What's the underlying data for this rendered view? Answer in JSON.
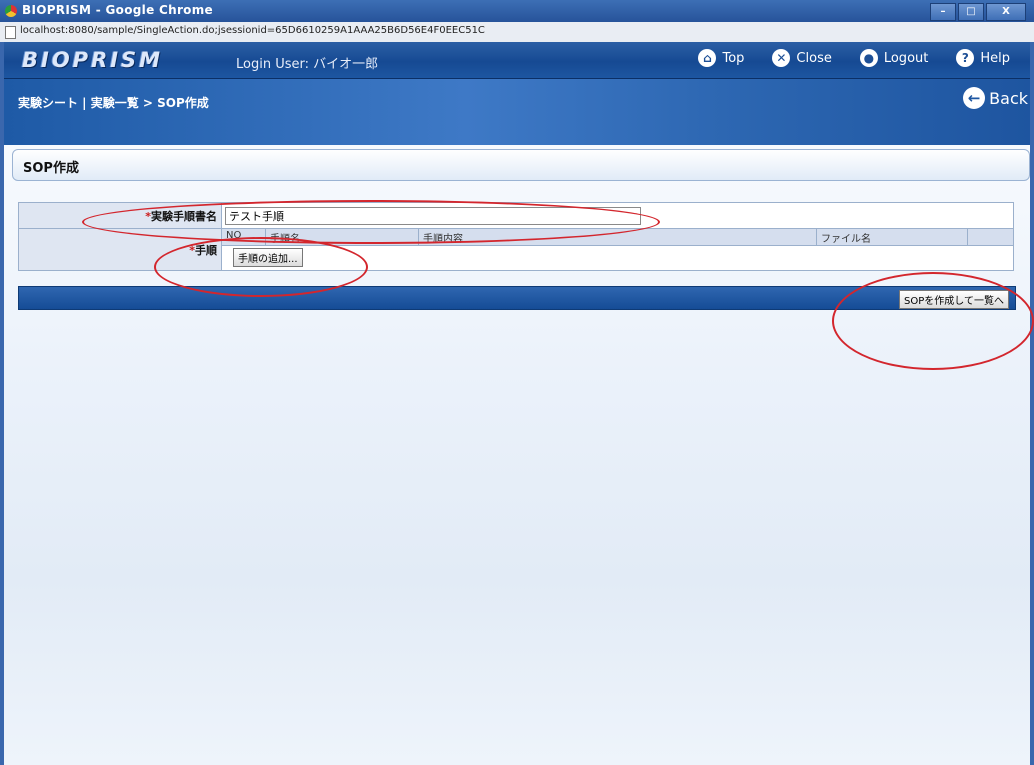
{
  "window": {
    "title": "BIOPRISM - Google Chrome",
    "controls": [
      "–",
      "□",
      "X"
    ],
    "url": "localhost:8080/sample/SingleAction.do;jsessionid=65D6610259A1AAA25B6D56E4F0EEC51C"
  },
  "header": {
    "logo": "BIOPRISM",
    "login_user": "Login User: バイオ一郎",
    "nav": [
      {
        "label": "Top",
        "icon": "home-icon",
        "glyph": "⌂"
      },
      {
        "label": "Close",
        "icon": "close-icon",
        "glyph": "✕"
      },
      {
        "label": "Logout",
        "icon": "logout-icon",
        "glyph": "●"
      },
      {
        "label": "Help",
        "icon": "help-icon",
        "glyph": "?"
      }
    ]
  },
  "breadcrumb": "実験シート | 実験一覧 > SOP作成",
  "back": {
    "label": "Back",
    "glyph": "←"
  },
  "section_title": "SOP作成",
  "form": {
    "required_mark": "*",
    "name_label": "実験手順書名",
    "name_value": "テスト手順",
    "steps_label": "手順",
    "steps_columns": [
      "NO",
      "手順名",
      "手順内容",
      "ファイル名"
    ],
    "add_step_button": "手順の追加..."
  },
  "actions": {
    "submit_label": "SOPを作成して一覧へ"
  },
  "colors": {
    "header_blue": "#164a93",
    "annotation_red": "#d3262d",
    "required_red": "#cc1a1a"
  }
}
